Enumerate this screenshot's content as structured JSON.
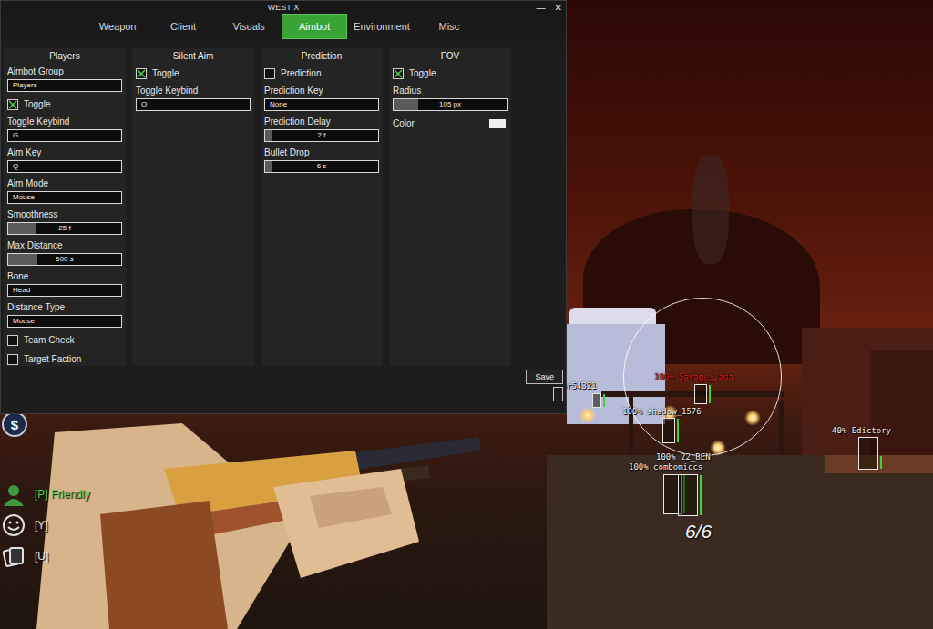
{
  "window": {
    "title": "WEST X",
    "controls": [
      "—",
      "✕"
    ]
  },
  "tabs": [
    {
      "label": "Weapon",
      "selected": false
    },
    {
      "label": "Client",
      "selected": false
    },
    {
      "label": "Visuals",
      "selected": false
    },
    {
      "label": "Aimbot",
      "selected": true
    },
    {
      "label": "Environment",
      "selected": false
    },
    {
      "label": "Misc",
      "selected": false
    }
  ],
  "columns": [
    {
      "title": "Players",
      "items": [
        {
          "kind": "field",
          "label": "Aimbot Group",
          "value": "Players"
        },
        {
          "kind": "checkbox",
          "label": "Toggle",
          "checked": true
        },
        {
          "kind": "field",
          "label": "Toggle Keybind",
          "value": "G"
        },
        {
          "kind": "field",
          "label": "Aim Key",
          "value": "Q"
        },
        {
          "kind": "field",
          "label": "Aim Mode",
          "value": "Mouse"
        },
        {
          "kind": "slider",
          "label": "Smoothness",
          "value": "25 f",
          "level": 0.25
        },
        {
          "kind": "slider",
          "label": "Max Distance",
          "value": "500 s",
          "level": 0.26
        },
        {
          "kind": "field",
          "label": "Bone",
          "value": "Head"
        },
        {
          "kind": "field",
          "label": "Distance Type",
          "value": "Mouse"
        },
        {
          "kind": "checkbox",
          "label": "Team Check",
          "checked": false
        },
        {
          "kind": "checkbox",
          "label": "Target Faction",
          "checked": false
        }
      ]
    },
    {
      "title": "Silent Aim",
      "items": [
        {
          "kind": "checkbox",
          "label": "Toggle",
          "checked": true
        },
        {
          "kind": "field",
          "label": "Toggle Keybind",
          "value": "O"
        }
      ]
    },
    {
      "title": "Prediction",
      "items": [
        {
          "kind": "checkbox",
          "label": "Prediction",
          "checked": false
        },
        {
          "kind": "field",
          "label": "Prediction Key",
          "value": "None"
        },
        {
          "kind": "slider",
          "label": "Prediction Delay",
          "value": "2 f",
          "level": 0.06
        },
        {
          "kind": "slider",
          "label": "Bullet Drop",
          "value": "6 s",
          "level": 0.06
        }
      ]
    },
    {
      "title": "FOV",
      "items": [
        {
          "kind": "checkbox",
          "label": "Toggle",
          "checked": true
        },
        {
          "kind": "slider",
          "label": "Radius",
          "value": "105 px",
          "level": 0.22
        },
        {
          "kind": "color",
          "label": "Color",
          "color": "#eeeeee"
        }
      ]
    }
  ],
  "footer": {
    "save": "Save"
  },
  "hud": {
    "money": "$",
    "binds": [
      {
        "label": "[P] Friendly",
        "color": "#4fd04f"
      },
      {
        "label": "[Y]",
        "color": "#e8e8e8"
      },
      {
        "label": "[U]",
        "color": "#e8e8e8"
      }
    ],
    "ammo": "6/6"
  },
  "esp": [
    {
      "label": "100% Greenkor54321",
      "color": "#f0f0f0",
      "health": 1
    },
    {
      "label": "100% Savage_Jada",
      "color": "#d42020",
      "health": 1
    },
    {
      "label": "100% shadow_1576",
      "color": "#f0f0f0",
      "health": 1
    },
    {
      "label": "100% 22_BEN",
      "color": "#f0f0f0",
      "health": 1
    },
    {
      "label": "100% combomiccs",
      "color": "#f0f0f0",
      "health": 1
    },
    {
      "label": "40% Edictory",
      "color": "#f0f0f0",
      "health": 0.4
    }
  ]
}
